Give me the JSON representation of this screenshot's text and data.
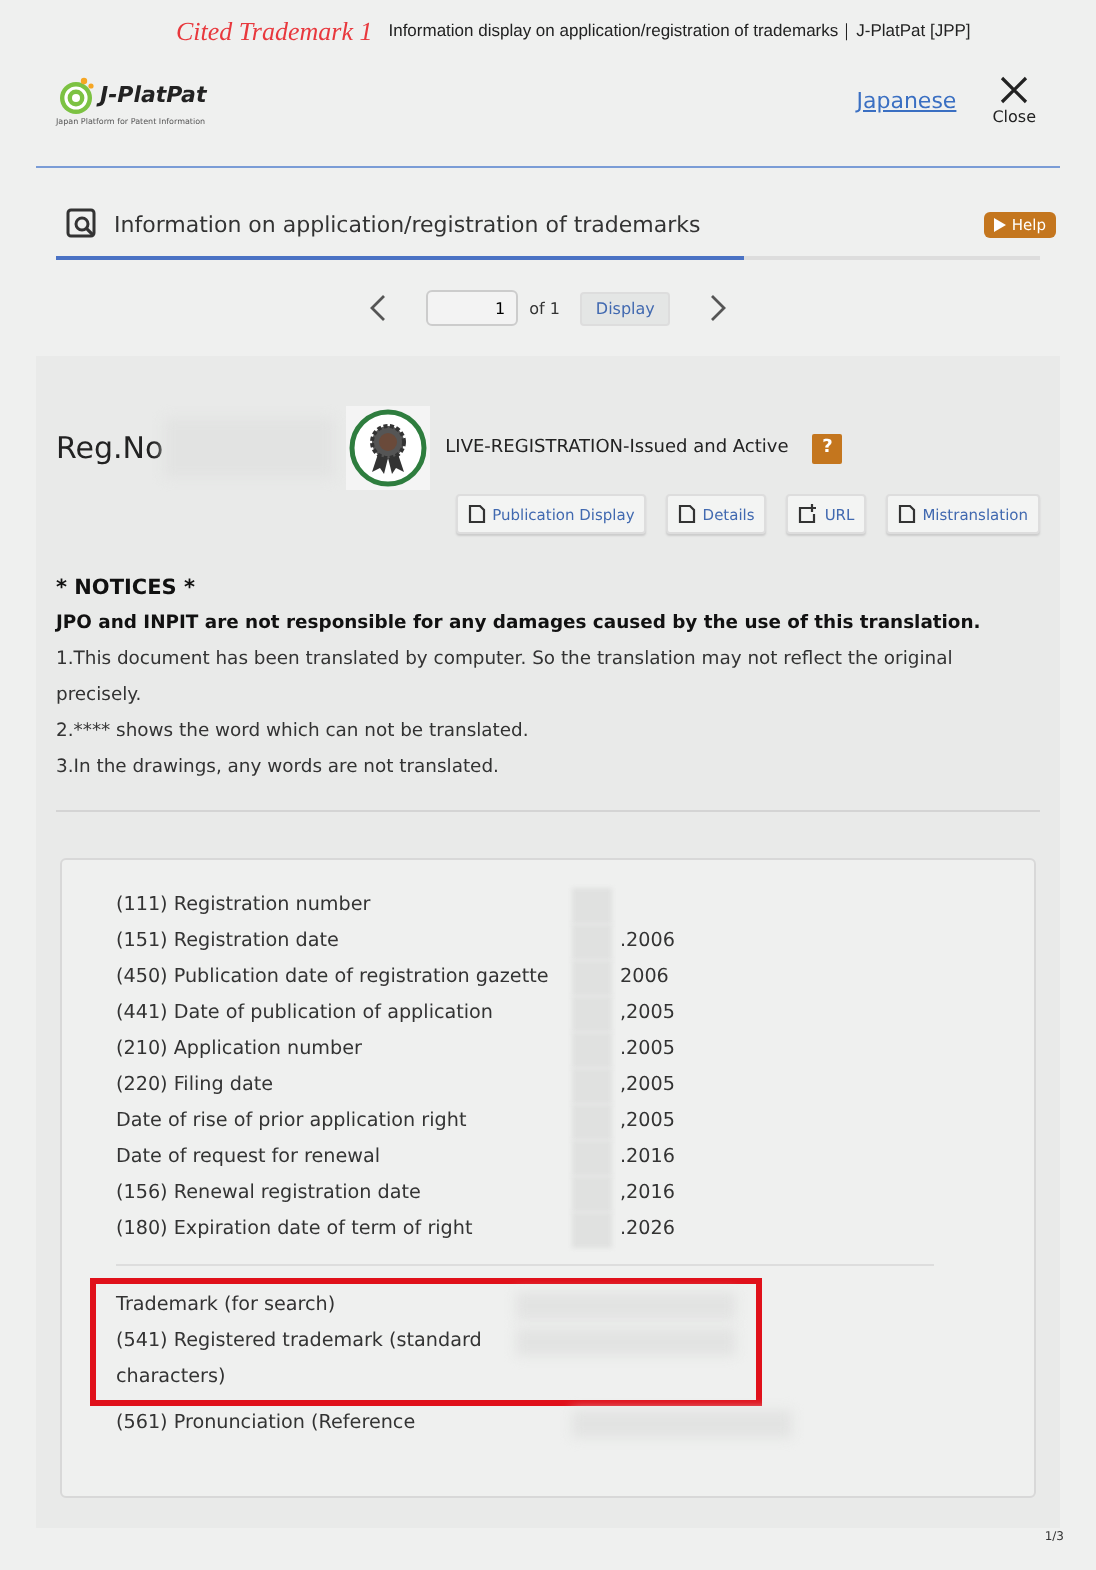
{
  "tab_header": {
    "annotation": "Cited Trademark 1",
    "title": "Information display on application/registration of trademarks｜J-PlatPat [JPP]"
  },
  "header": {
    "logo": "J-PlatPat",
    "logo_subtitle": "Japan Platform for Patent Information",
    "language_link": "Japanese",
    "close": "Close"
  },
  "section": {
    "title": "Information on application/registration of trademarks",
    "help": "Help"
  },
  "pager": {
    "page": "1",
    "of": "of 1",
    "display": "Display"
  },
  "record": {
    "reg_label": "Reg.No",
    "status": "LIVE-REGISTRATION-Issued and Active",
    "status_help": "?",
    "actions": [
      {
        "label": "Publication Display",
        "kind": "doc"
      },
      {
        "label": "Details",
        "kind": "doc"
      },
      {
        "label": "URL",
        "kind": "link"
      },
      {
        "label": "Mistranslation",
        "kind": "doc"
      }
    ]
  },
  "notices": {
    "title": "* NOTICES *",
    "disclaimer": "JPO and INPIT are not responsible for any damages caused by the use of this translation.",
    "items": [
      "1.This document has been translated by computer. So the translation may not reflect the original precisely.",
      "2.**** shows the word which can not be translated.",
      "3.In the drawings, any words are not translated."
    ]
  },
  "fields": [
    {
      "label": "(111) Registration number"
    },
    {
      "label": "(151) Registration date",
      "value": ".2006"
    },
    {
      "label": "(450) Publication date of registration gazette",
      "value": "2006"
    },
    {
      "label": "(441) Date of publication of application",
      "value": ",2005"
    },
    {
      "label": "(210) Application number",
      "value": ".2005"
    },
    {
      "label": "(220) Filing date",
      "value": ",2005"
    },
    {
      "label": "Date of rise of prior application right",
      "value": ",2005"
    },
    {
      "label": "Date of request for renewal",
      "value": ".2016"
    },
    {
      "label": "(156) Renewal registration date",
      "value": ",2016"
    },
    {
      "label": "(180) Expiration date of term of right",
      "value": ".2026"
    }
  ],
  "trademark_fields": [
    {
      "label": "Trademark (for search)",
      "highlighted": true
    },
    {
      "label": "(541) Registered trademark (standard characters)",
      "highlighted": true
    },
    {
      "label": "(561) Pronunciation (Reference",
      "highlighted": false
    }
  ],
  "page_indicator": "1/3"
}
